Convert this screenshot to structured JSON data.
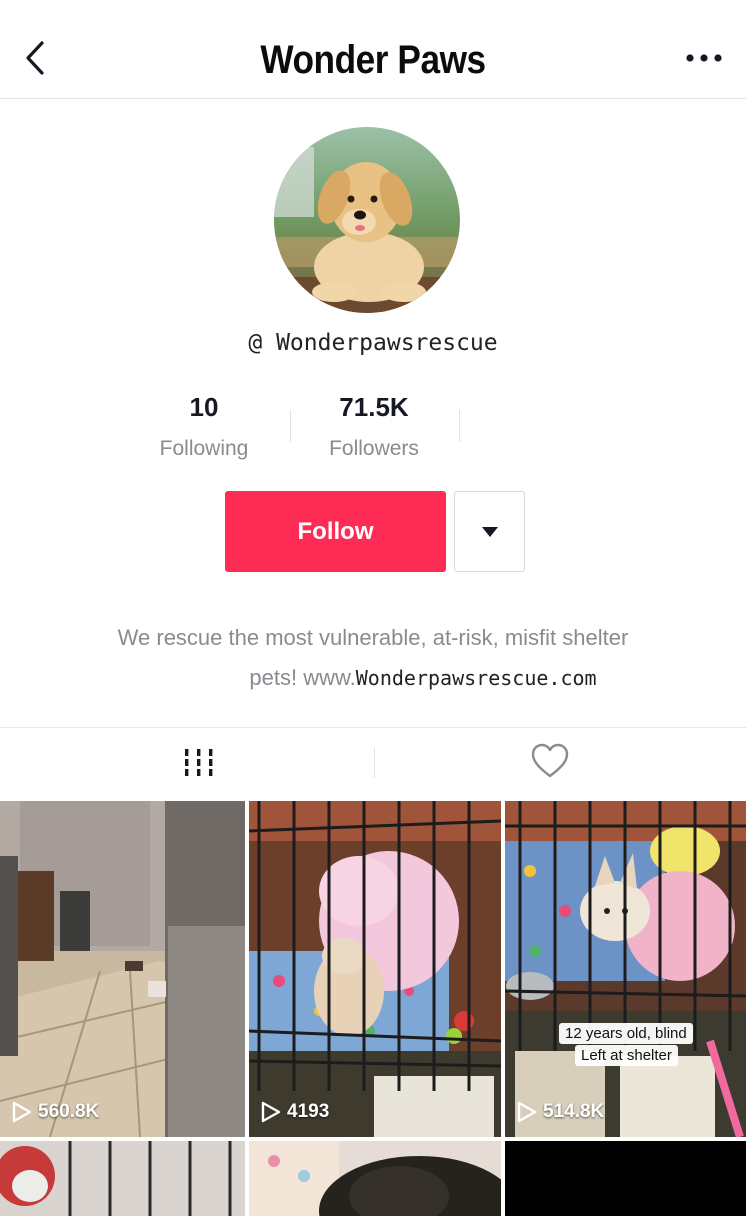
{
  "header": {
    "title": "Wonder Paws",
    "back_icon": "chevron-left-icon",
    "more_icon": "more-horizontal-icon"
  },
  "profile": {
    "handle": "@ Wonderpawsrescue",
    "avatar": "puppy-photo"
  },
  "stats": {
    "following_count": "10",
    "following_label": "Following",
    "followers_count": "71.5K",
    "followers_label": "Followers"
  },
  "actions": {
    "follow_label": "Follow",
    "dropdown_icon": "caret-down-icon"
  },
  "bio": {
    "line1": "We rescue the most vulnerable, at-risk, misfit shelter",
    "line2_prefix": "pets! www.",
    "line2_url": "Wonderpawsrescue.com"
  },
  "tabs": {
    "videos_icon": "grid-videos-icon",
    "liked_icon": "heart-icon"
  },
  "videos": [
    {
      "views": "560.8K"
    },
    {
      "views": "4193"
    },
    {
      "views": "514.8K",
      "caption_line1": "12 years old, blind",
      "caption_line2": "Left at shelter"
    }
  ],
  "colors": {
    "accent": "#fe2c55",
    "text": "#161823",
    "muted": "#8a8b91"
  }
}
